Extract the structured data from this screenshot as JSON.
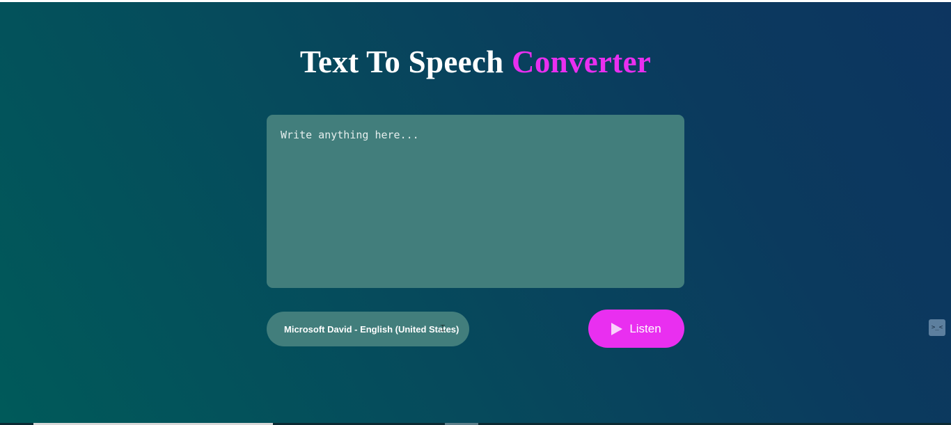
{
  "header": {
    "title_main": "Text To Speech ",
    "title_accent": "Converter"
  },
  "editor": {
    "placeholder": "Write anything here...",
    "value": ""
  },
  "voice": {
    "selected": "Microsoft David - English (United States)"
  },
  "listen_button": {
    "label": "Listen",
    "icon": "play-icon"
  },
  "extension": {
    "icon": "terminal-icon",
    "glyph": ">_<"
  },
  "colors": {
    "accent": "#e92ff0",
    "panel": "#427e7c",
    "background_start": "#005a5a",
    "background_end": "#0d3560"
  }
}
